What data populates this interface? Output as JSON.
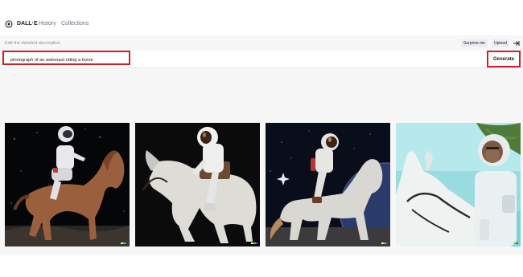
{
  "header": {
    "brand": "DALL·E",
    "nav": [
      "History",
      "Collections"
    ]
  },
  "editor": {
    "hint": "Edit the detailed description",
    "surprise_label": "Surprise me",
    "upload_label": "Upload",
    "prompt_value": "photograph of an astronaut riding a horse",
    "generate_label": "Generate"
  },
  "results": [
    {
      "horse": "brown",
      "background": "starry space"
    },
    {
      "horse": "white",
      "background": "black"
    },
    {
      "horse": "white",
      "background": "space with planet"
    },
    {
      "horse": "white",
      "background": "teal sky"
    }
  ],
  "colors": {
    "highlight": "#d01e2b",
    "signature": [
      "#ffff66",
      "#42ffff",
      "#51da4c",
      "#ff6e3c",
      "#3c46ff"
    ]
  }
}
